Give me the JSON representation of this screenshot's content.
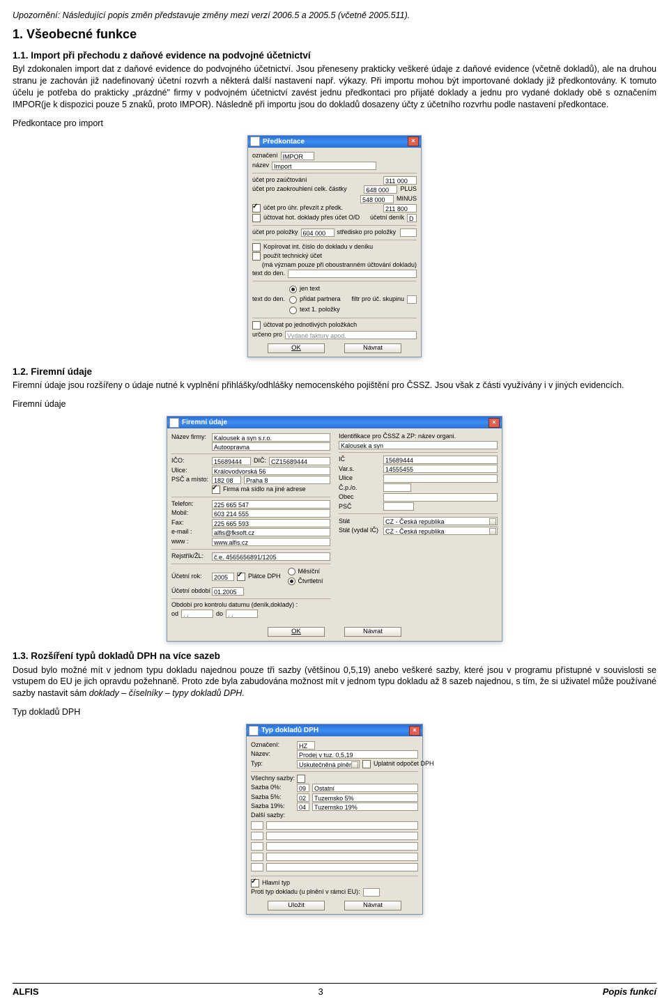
{
  "notice": "Upozornění: Následující popis změn představuje změny mezi verzí 2006.5 a 2005.5 (včetně 2005.511).",
  "h1": "1.  Všeobecné funkce",
  "s11": {
    "title": "1.1.  Import při přechodu z daňové evidence na podvojné účetnictví",
    "para": "Byl zdokonalen import dat z daňové evidence do podvojného účetnictví. Jsou přeneseny prakticky veškeré údaje z daňové evidence (včetně dokladů), ale na druhou stranu je zachován již nadefinovaný účetní rozvrh a některá další nastavení např. výkazy. Při importu mohou být importované doklady již předkontovány. K tomuto účelu je potřeba do prakticky „prázdné\" firmy v podvojném účetnictví zavést jednu předkontaci pro přijaté doklady a jednu pro vydané doklady obě s označením IMPOR(je k dispozici pouze 5 znaků, proto IMPOR). Následně při importu jsou do dokladů dosazeny účty z účetního rozvrhu podle nastavení předkontace."
  },
  "label1": "Předkontace pro import",
  "d1": {
    "title": "Předkontace",
    "oznaceni": "IMPOR",
    "nazev": "Import",
    "ucet_zauc": "311 000",
    "ucet_zaokr_plus": "648 000",
    "plus": "PLUS",
    "ucet_zaokr_minus": "548 000",
    "minus": "MINUS",
    "ucet_uhr": "211 800",
    "hot_oD": "účetní deník",
    "hot_oD_v": "D",
    "ucet_pol": "604 000",
    "stredisko": "středisko pro položky",
    "kopir": "Kopírovat int. číslo do dokladu v deníku",
    "tech": "použít technický účet",
    "tech2": "(má význam pouze při oboustranném účtování dokladu)",
    "text_do_den": "text do den.",
    "jen_text": "jen text",
    "pridat_part": "přidat partnera",
    "text1": "text 1. položky",
    "filtr": "filtr pro úč. skupinu",
    "uctpol": "účtovat po jednotlivých položkách",
    "urcenopro": "určeno pro",
    "urcenopro_v": "Vydané faktury apod.",
    "ok": "OK",
    "navrat": "Návrat",
    "l_oznaceni": "označení",
    "l_nazev": "název",
    "l_ucet_zauc": "účet pro zaúčtování",
    "l_ucet_zaokr": "účet pro zaokrouhlení celk. částky",
    "l_ucet_uhr": "účet pro úhr. převzít z předk.",
    "l_hot_oD": "účtovat hot. doklady přes účet O/D",
    "l_ucet_pol": "účet pro položky"
  },
  "s12": {
    "title": "1.2.  Firemní údaje",
    "para": "Firemní údaje jsou rozšířeny o údaje nutné k vyplnění přihlášky/odhlášky nemocenského pojištění pro ČSSZ. Jsou však z části využívány i v jiných evidencích."
  },
  "label2": "Firemní údaje",
  "d2": {
    "title": "Firemní údaje",
    "nazevf": "Kalousek a syn  s.r.o.",
    "nazevf2": "Autoopravna",
    "ident": "Identifikace pro ČSSZ a ZP: název organi.",
    "ident_v": "Kalousek a syn",
    "ico": "15689444",
    "dic": "CZ15689444",
    "ic": "15689444",
    "ulice": "Královodvorská 56",
    "vars": "14555455",
    "psc": "182 08",
    "mesto": "Praha 8",
    "sidlo": "Firma má sídlo na jiné adrese",
    "tel": "225 665 547",
    "mobil": "603 214 555",
    "fax": "225 665 593",
    "email": "alfis@fksoft.cz",
    "www": "www.alfis.cz",
    "rejstrik": "č.e. 4565656891/1205",
    "urok": "2005",
    "platce": "Plátce DPH",
    "mesicni": "Měsíční",
    "ctvrt": "Čtvrtletní",
    "uobdobi": "01.2005",
    "obdobi": "Období pro kontrolu datumu (deník,doklady) :",
    "od": "od",
    "do": "do",
    "blank": ". .",
    "stat": "CZ - Česká republika",
    "statv": "CZ - Česká republika",
    "ok": "OK",
    "navrat": "Návrat",
    "l": {
      "nazev": "Název firmy:",
      "ico": "IČO:",
      "dic": "DIČ:",
      "ulice": "Ulice:",
      "psc": "PSČ a místo:",
      "tel": "Telefon:",
      "mobil": "Mobil:",
      "fax": "Fax:",
      "email": "e-mail :",
      "www": "www :",
      "rej": "Rejstřík/ŽL:",
      "urok": "Účetní rok:",
      "uobd": "Účetní období :",
      "ic": "IČ",
      "vars": "Var.s.",
      "uliceR": "Ulice",
      "cp": "Č.p./o.",
      "obec": "Obec",
      "pscR": "PSČ",
      "stat": "Stát",
      "statv": "Stát (vydal IČ)"
    }
  },
  "s13": {
    "title": "1.3.  Rozšíření typů dokladů DPH na více sazeb",
    "para1": "Dosud bylo možné mít v jednom typu dokladu najednou pouze tři sazby (většinou 0,5,19) anebo veškeré sazby, které jsou v programu přístupné  v souvislosti se vstupem do EU je jich opravdu požehnaně. Proto zde byla zabudována možnost mít v jednom typu dokladu až 8 sazeb najednou, s tím, že si uživatel může používané sazby nastavit sám ",
    "em": "doklady – číselníky – typy dokladů DPH."
  },
  "label3": "Typ dokladů DPH",
  "d3": {
    "title": "Typ dokladů DPH",
    "l": {
      "ozn": "Označení:",
      "naz": "Název:",
      "typ": "Typ:",
      "vsech": "Všechny sazby:",
      "s0": "Sazba  0%:",
      "s5": "Sazba  5%:",
      "s19": "Sazba 19%:",
      "dal": "Další sazby:"
    },
    "ozn": "HZ",
    "naz": "Prodej v tuz. 0,5,19",
    "typ": "Uskutečněná plněn",
    "upl": "Uplatnit odpočet DPH",
    "s0": "09",
    "s0t": "Ostatní",
    "s5": "02",
    "s5t": "Tuzemsko 5%",
    "s19": "04",
    "s19t": "Tuzemsko 19%",
    "hl": "Hlavní typ",
    "proti": "Proti typ dokladu (u plnění v rámci EU):",
    "ulozit": "Uložit",
    "navrat": "Návrat"
  },
  "footer": {
    "left": "ALFIS",
    "center": "3",
    "right": "Popis funkcí"
  }
}
